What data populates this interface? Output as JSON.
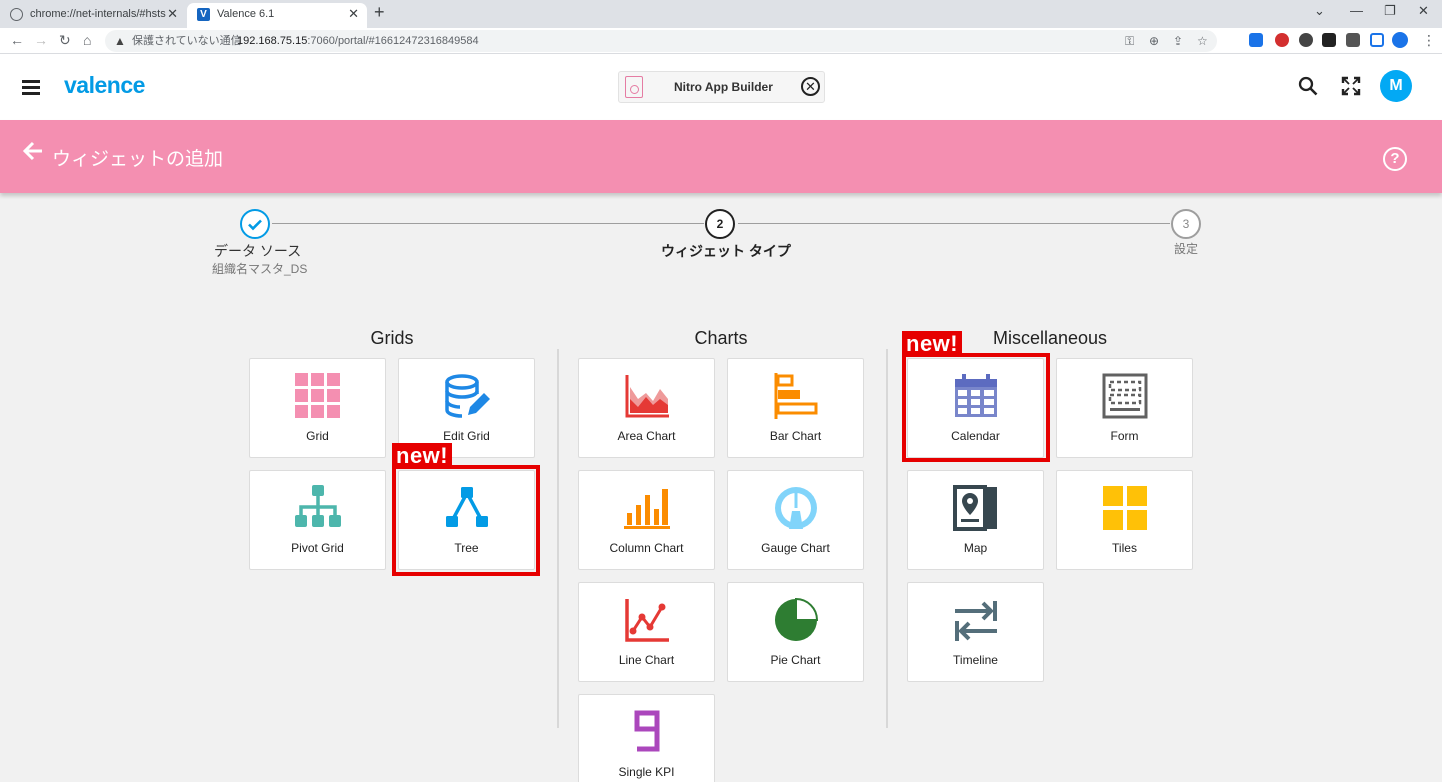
{
  "browser": {
    "tabs": [
      {
        "title": "chrome://net-internals/#hsts"
      },
      {
        "title": "Valence 6.1"
      }
    ],
    "address": {
      "security_label": "保護されていない通信",
      "host": "192.168.75.15",
      "path": ":7060/portal/#16612472316849584"
    }
  },
  "app": {
    "logo": "valence",
    "open_app": "Nitro App Builder",
    "avatar_initial": "M"
  },
  "banner": {
    "title": "ウィジェットの追加"
  },
  "stepper": {
    "steps": [
      {
        "number": "",
        "label": "データ ソース",
        "sub": "組織名マスタ_DS",
        "state": "done"
      },
      {
        "number": "2",
        "label": "ウィジェット タイプ",
        "sub": "",
        "state": "active"
      },
      {
        "number": "3",
        "label": "設定",
        "sub": "",
        "state": "pending"
      }
    ]
  },
  "sections": {
    "grids": {
      "title": "Grids",
      "items": [
        "Grid",
        "Edit Grid",
        "Pivot Grid",
        "Tree"
      ]
    },
    "charts": {
      "title": "Charts",
      "items": [
        "Area Chart",
        "Bar Chart",
        "Column Chart",
        "Gauge Chart",
        "Line Chart",
        "Pie Chart",
        "Single KPI"
      ]
    },
    "misc": {
      "title": "Miscellaneous",
      "items": [
        "Calendar",
        "Form",
        "Map",
        "Tiles",
        "Timeline"
      ]
    }
  },
  "annotations": {
    "new_label": "new!"
  },
  "colors": {
    "accent": "#039be5",
    "banner": "#f48fb1",
    "highlight": "#e60000"
  }
}
